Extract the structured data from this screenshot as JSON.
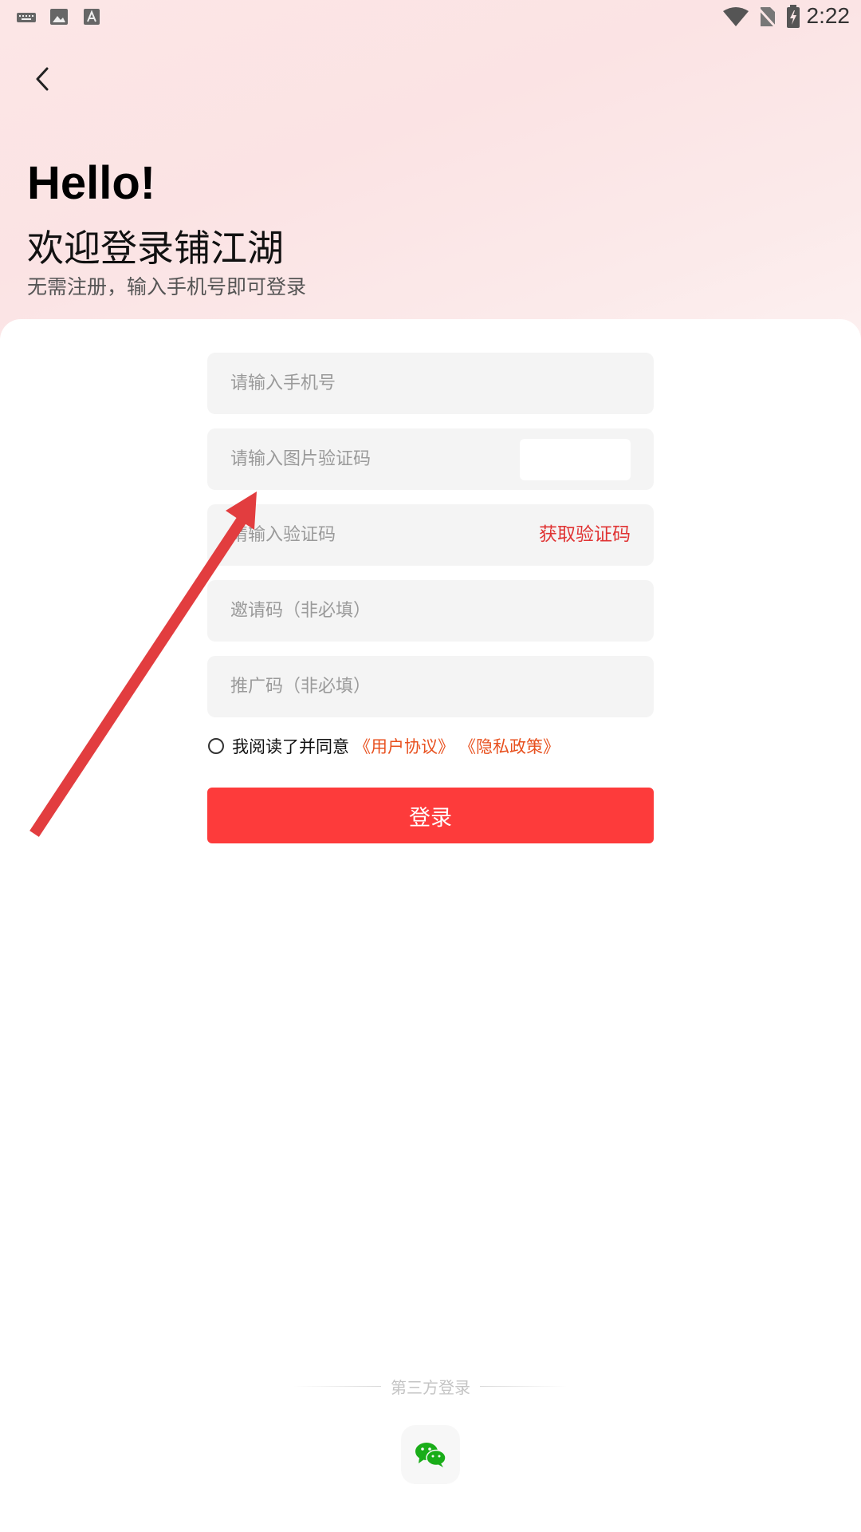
{
  "status_bar": {
    "time": "2:22",
    "left_icons": [
      "keyboard-icon",
      "image-icon",
      "text-icon"
    ],
    "right_icons": [
      "wifi-icon",
      "no-sim-icon",
      "battery-charging-icon"
    ]
  },
  "header": {
    "back_icon": "chevron-left-icon",
    "hello": "Hello!",
    "welcome": "欢迎登录铺江湖",
    "subtitle": "无需注册，输入手机号即可登录"
  },
  "form": {
    "phone_placeholder": "请输入手机号",
    "image_code_placeholder": "请输入图片验证码",
    "sms_code_placeholder": "请输入验证码",
    "get_code_label": "获取验证码",
    "invite_placeholder": "邀请码（非必填）",
    "promo_placeholder": "推广码（非必填）",
    "agree_text": "我阅读了并同意",
    "user_agreement": "《用户协议》",
    "privacy_policy": "《隐私政策》",
    "login_label": "登录"
  },
  "third_party": {
    "label": "第三方登录",
    "wechat_icon": "wechat-icon"
  },
  "colors": {
    "accent": "#fd3b3b",
    "link": "#e8511f",
    "get_code": "#e03434",
    "annotation_arrow": "#e23d3f",
    "wechat_green": "#1aad19"
  }
}
